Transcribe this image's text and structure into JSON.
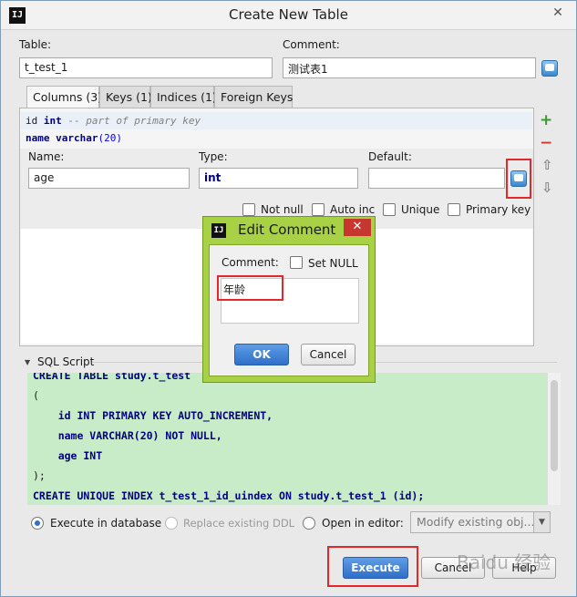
{
  "window": {
    "title": "Create New Table",
    "app_icon": "IJ",
    "close_glyph": "✕"
  },
  "form": {
    "table_label": "Table:",
    "table_value": "t_test_1",
    "comment_label": "Comment:",
    "comment_value": "测试表1"
  },
  "tabs": [
    {
      "label": "Columns (3)",
      "active": true
    },
    {
      "label": "Keys (1)"
    },
    {
      "label": "Indices (1)"
    },
    {
      "label": "Foreign Keys"
    }
  ],
  "columns_preview": {
    "row1": {
      "name": "id",
      "type": "int",
      "comment": "-- part of primary key"
    },
    "row2": {
      "name": "name",
      "type": "varchar",
      "size": "(20)"
    }
  },
  "column_editor": {
    "name_label": "Name:",
    "name_value": "age",
    "type_label": "Type:",
    "type_value": "int",
    "default_label": "Default:",
    "default_value": "",
    "checks": [
      "Not null",
      "Auto inc",
      "Unique",
      "Primary key"
    ]
  },
  "side_buttons": {
    "add": "+",
    "remove": "−",
    "up": "⇧",
    "down": "⇩"
  },
  "edit_comment": {
    "title": "Edit Comment",
    "icon": "IJ",
    "close_glyph": "✕",
    "comment_label": "Comment:",
    "set_null_label": "Set NULL",
    "comment_value": "年龄",
    "ok_label": "OK",
    "cancel_label": "Cancel"
  },
  "sql": {
    "section_label": "SQL Script",
    "lines": [
      "CREATE TABLE study.t_test",
      "(",
      "    id INT PRIMARY KEY AUTO_INCREMENT,",
      "    name VARCHAR(20) NOT NULL,",
      "    age INT",
      ");",
      "CREATE UNIQUE INDEX t_test_1_id_uindex ON study.t_test_1 (id);"
    ]
  },
  "options": {
    "execute_db": "Execute in database",
    "replace_ddl": "Replace existing DDL",
    "open_editor": "Open in editor:",
    "editor_mode": "Modify existing obj..."
  },
  "buttons": {
    "execute": "Execute",
    "cancel": "Cancel",
    "help": "Help"
  },
  "watermark": "Baidu 经验"
}
